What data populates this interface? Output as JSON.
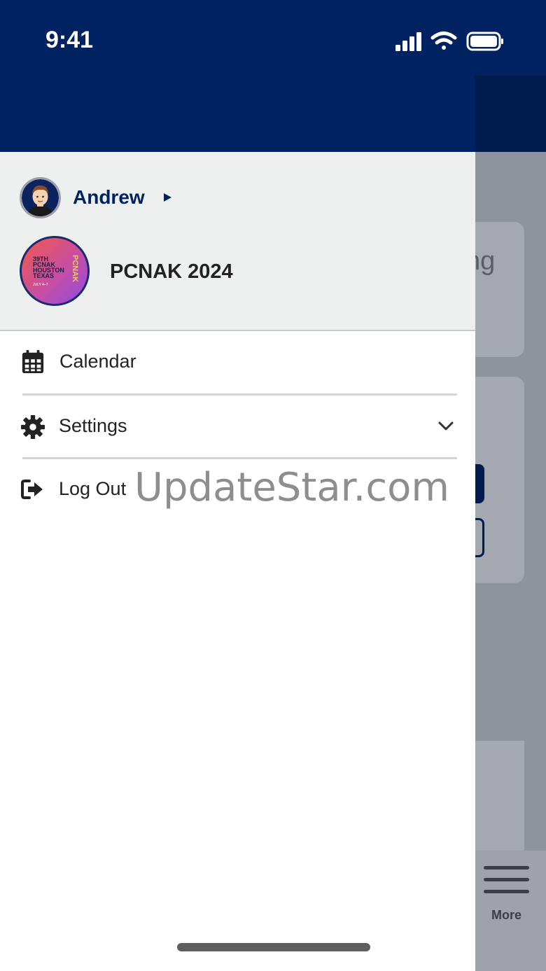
{
  "status_bar": {
    "time": "9:41"
  },
  "drawer": {
    "user": {
      "name": "Andrew"
    },
    "event": {
      "title": "PCNAK 2024",
      "logo_text": "39TH PCNAK HOUSTON TEXAS",
      "logo_dates": "JULY 4–7",
      "logo_vertical": "PCNAK"
    },
    "menu": [
      {
        "label": "Calendar",
        "icon": "calendar-icon"
      },
      {
        "label": "Settings",
        "icon": "gear-icon",
        "expandable": true
      },
      {
        "label": "Log Out",
        "icon": "logout-icon"
      }
    ]
  },
  "background": {
    "card_fragment": "ng",
    "tab_more_label": "More"
  },
  "watermark": "UpdateStar.com",
  "colors": {
    "header_navy": "#002261",
    "drawer_header_bg": "#eef0f0",
    "overlay_gray": "#8e949d"
  }
}
